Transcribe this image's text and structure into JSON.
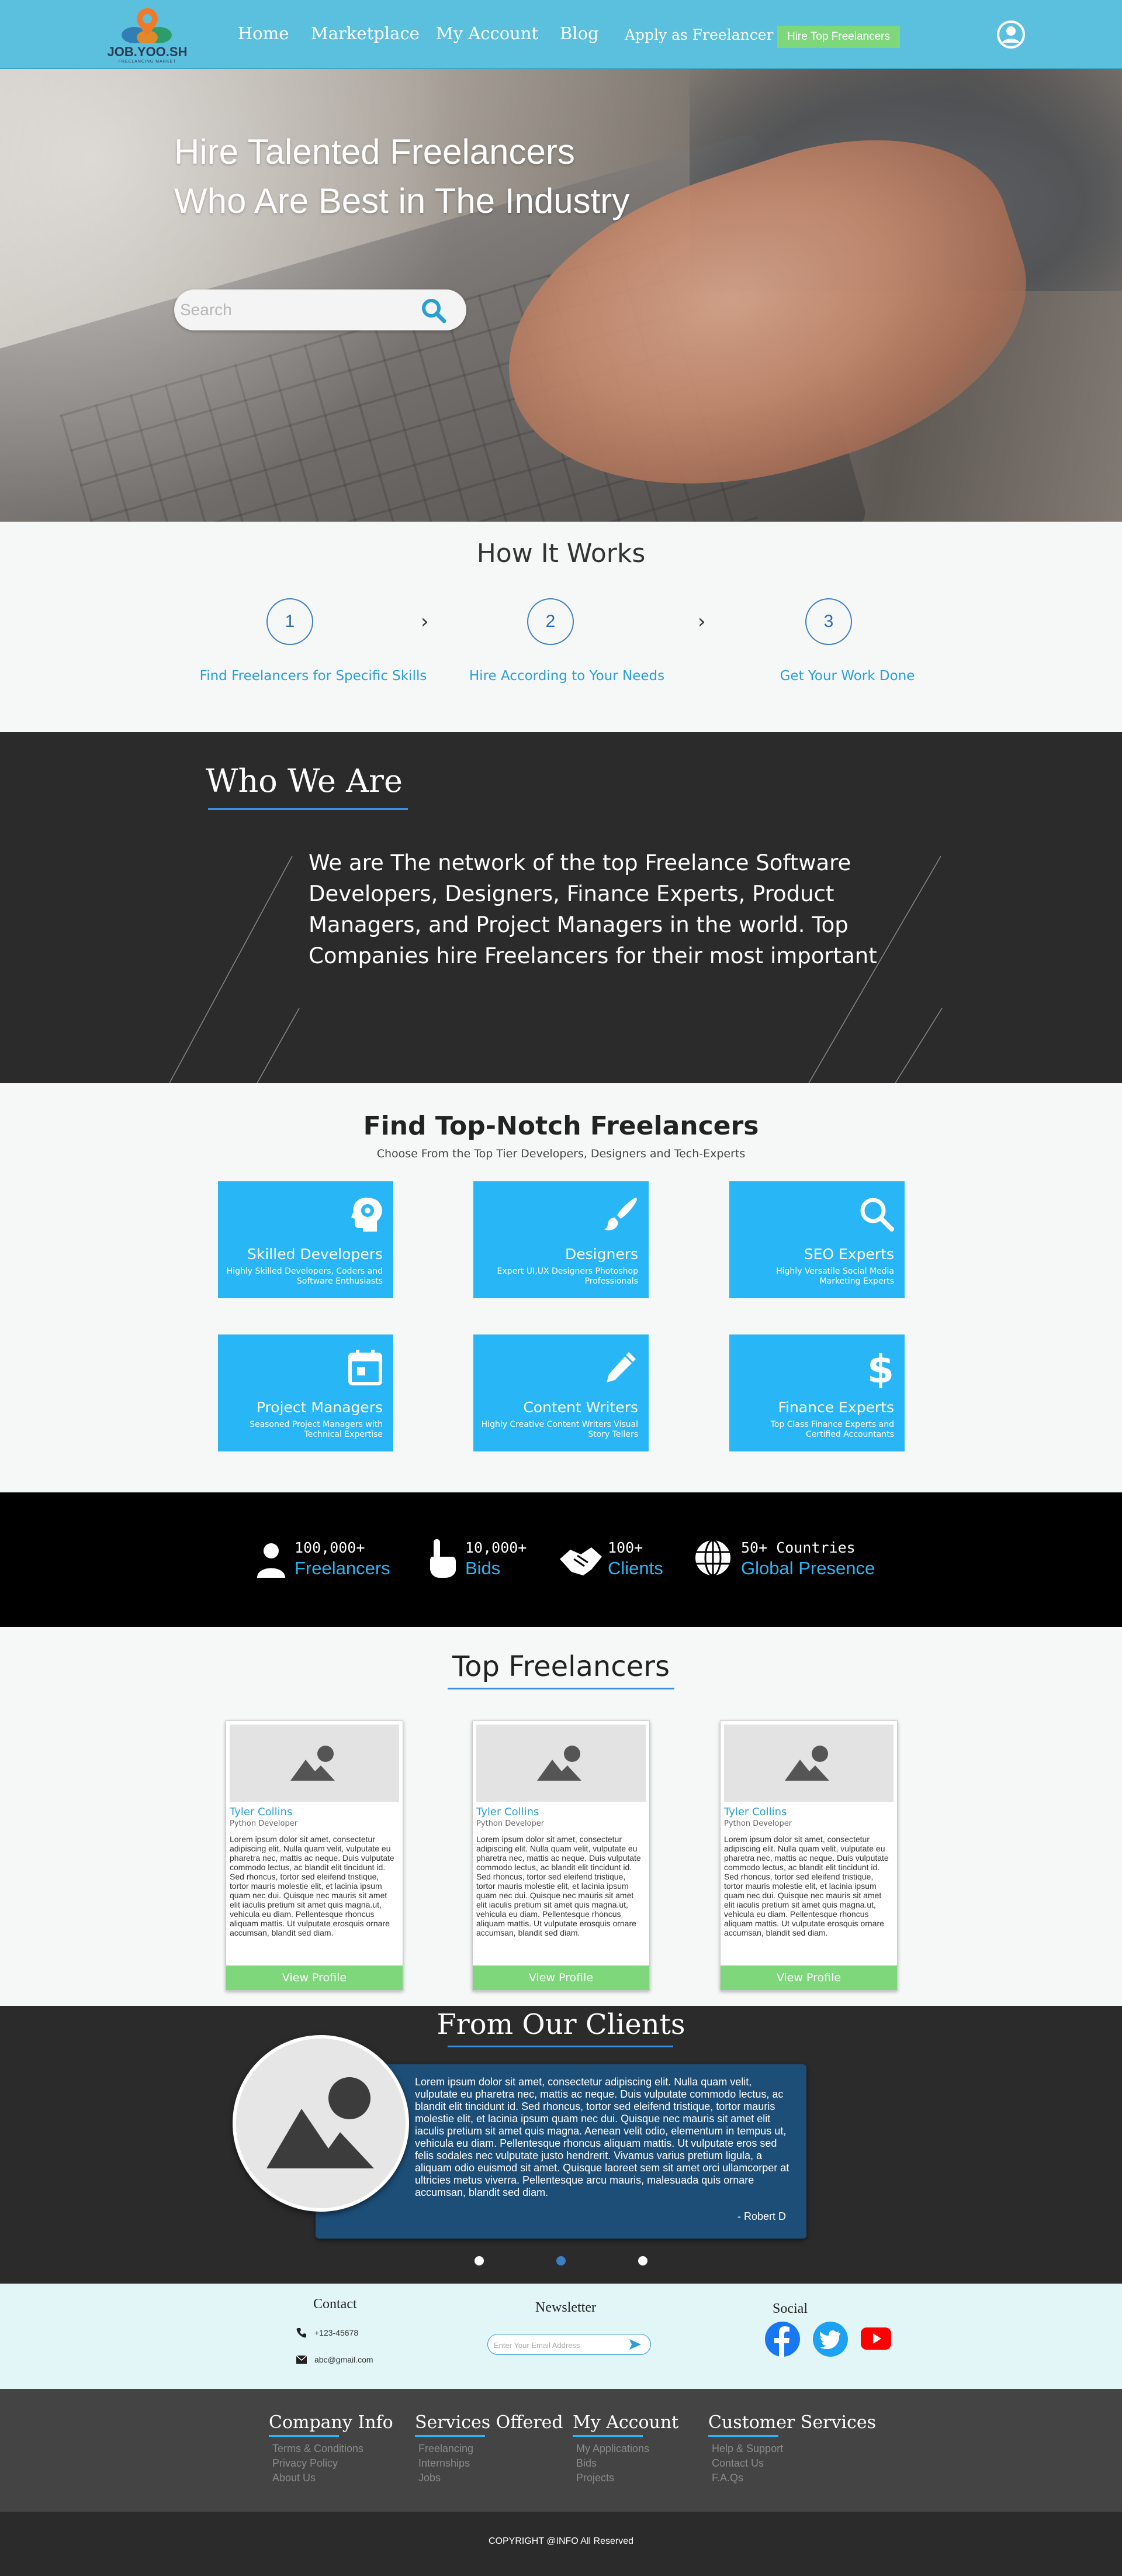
{
  "nav": {
    "logo_text": "JOB.YOO.SH",
    "logo_tagline": "FREELANCING MARKET",
    "links": [
      "Home",
      "Marketplace",
      "My Account",
      "Blog"
    ],
    "apply": "Apply as Freelancer",
    "hire_button": "Hire Top Freelancers",
    "user_icon": "user-circle-icon",
    "bg_color": "#5bc0de"
  },
  "hero": {
    "headline": "Hire Talented Freelancers Who Are Best in The Industry",
    "search_placeholder": "Search"
  },
  "how": {
    "title": "How It Works",
    "steps": [
      {
        "num": "1",
        "label": "Find Freelancers for Specific Skills"
      },
      {
        "num": "2",
        "label": "Hire According to Your Needs"
      },
      {
        "num": "3",
        "label": "Get Your Work Done"
      }
    ]
  },
  "who": {
    "title": "Who We Are",
    "text": "We are The network of the top Freelance Software Developers, Designers, Finance Experts, Product Managers, and Project Managers in the world. Top Companies hire Freelancers for their most important"
  },
  "find": {
    "title_bold": "Find Top-Notch",
    "title_rest": "Freelancers",
    "subtitle": "Choose From the Top Tier Developers, Designers and Tech-Experts",
    "card_color": "#29b6f6",
    "cards": [
      {
        "title": "Skilled Developers",
        "desc": "Highly Skilled Developers, Coders and Software Enthusiasts",
        "icon": "brain-gear-icon"
      },
      {
        "title": "Designers",
        "desc": "Expert UI,UX Designers Photoshop Professionals",
        "icon": "paintbrush-icon"
      },
      {
        "title": "SEO Experts",
        "desc": "Highly Versatile Social Media Marketing Experts",
        "icon": "search-icon"
      },
      {
        "title": "Project Managers",
        "desc": "Seasoned Project Managers with Technical Expertise",
        "icon": "calendar-icon"
      },
      {
        "title": "Content Writers",
        "desc": "Highly Creative Content Writers Visual Story Tellers",
        "icon": "pencil-icon"
      },
      {
        "title": "Finance Experts",
        "desc": "Top Class Finance Experts and Certified Accountants",
        "icon": "dollar-icon"
      }
    ]
  },
  "stats": [
    {
      "num": "100,000+",
      "label": "Freelancers",
      "icon": "person-icon"
    },
    {
      "num": "10,000+",
      "label": "Bids",
      "icon": "hand-pointer-icon"
    },
    {
      "num": "100+",
      "label": "Clients",
      "icon": "handshake-icon"
    },
    {
      "num": "50+ Countries",
      "label": "Global Presence",
      "icon": "globe-icon"
    }
  ],
  "top": {
    "title": "Top Freelancers",
    "view_label": "View Profile",
    "freelancers": [
      {
        "name": "Tyler Collins",
        "role": "Python Developer",
        "bio": "Lorem ipsum dolor sit amet, consectetur adipiscing elit. Nulla quam velit, vulputate eu pharetra nec, mattis ac neque. Duis vulputate commodo lectus, ac blandit elit tincidunt id. Sed rhoncus, tortor sed eleifend tristique, tortor mauris molestie elit, et lacinia ipsum quam nec dui. Quisque nec mauris sit amet elit iaculis pretium sit amet quis magna.ut, vehicula eu diam. Pellentesque rhoncus aliquam mattis. Ut vulputate erosquis ornare accumsan, blandit sed diam."
      },
      {
        "name": "Tyler Collins",
        "role": "Python Developer",
        "bio": "Lorem ipsum dolor sit amet, consectetur adipiscing elit. Nulla quam velit, vulputate eu pharetra nec, mattis ac neque. Duis vulputate commodo lectus, ac blandit elit tincidunt id. Sed rhoncus, tortor sed eleifend tristique, tortor mauris molestie elit, et lacinia ipsum quam nec dui. Quisque nec mauris sit amet elit iaculis pretium sit amet quis magna.ut, vehicula eu diam. Pellentesque rhoncus aliquam mattis. Ut vulputate erosquis ornare accumsan, blandit sed diam."
      },
      {
        "name": "Tyler Collins",
        "role": "Python Developer",
        "bio": "Lorem ipsum dolor sit amet, consectetur adipiscing elit. Nulla quam velit, vulputate eu pharetra nec, mattis ac neque. Duis vulputate commodo lectus, ac blandit elit tincidunt id. Sed rhoncus, tortor sed eleifend tristique, tortor mauris molestie elit, et lacinia ipsum quam nec dui. Quisque nec mauris sit amet elit iaculis pretium sit amet quis magna.ut, vehicula eu diam. Pellentesque rhoncus aliquam mattis. Ut vulputate erosquis ornare accumsan, blandit sed diam."
      }
    ]
  },
  "testimonial": {
    "title": "From Our Clients",
    "text": "Lorem ipsum dolor sit amet, consectetur adipiscing elit. Nulla quam velit, vulputate eu pharetra nec, mattis ac neque. Duis vulputate commodo lectus, ac blandit elit tincidunt id. Sed rhoncus, tortor sed eleifend tristique, tortor mauris molestie elit, et lacinia ipsum quam nec dui. Quisque nec mauris sit amet elit iaculis pretium sit amet quis magna. Aenean velit odio, elementum in tempus ut, vehicula eu diam. Pellentesque rhoncus aliquam mattis. Ut vulputate eros sed felis sodales nec vulputate justo hendrerit. Vivamus varius pretium ligula, a aliquam odio euismod sit amet. Quisque laoreet sem sit amet orci ullamcorper at ultricies metus viverra. Pellentesque arcu mauris, malesuada quis ornare accumsan, blandit sed diam.",
    "author": "-   Robert D",
    "active_slide": 2
  },
  "contact": {
    "title": "Contact",
    "phone": "+123-45678",
    "email": "abc@gmail.com",
    "newsletter_title": "Newsletter",
    "newsletter_placeholder": "Enter Your Email Address",
    "social_title": "Social",
    "social": [
      "facebook-icon",
      "twitter-icon",
      "youtube-icon"
    ]
  },
  "footer": {
    "columns": [
      {
        "title": "Company Info",
        "links": [
          "Terms & Conditions",
          "Privacy Policy",
          "About Us"
        ]
      },
      {
        "title": "Services Offered",
        "links": [
          "Freelancing",
          "Internships",
          "Jobs"
        ]
      },
      {
        "title": "My Account",
        "links": [
          "My Applications",
          "Bids",
          "Projects"
        ]
      },
      {
        "title": "Customer Services",
        "links": [
          "Help & Support",
          "Contact Us",
          "F.A.Qs"
        ]
      }
    ],
    "copyright": "COPYRIGHT @INFO All Reserved"
  }
}
